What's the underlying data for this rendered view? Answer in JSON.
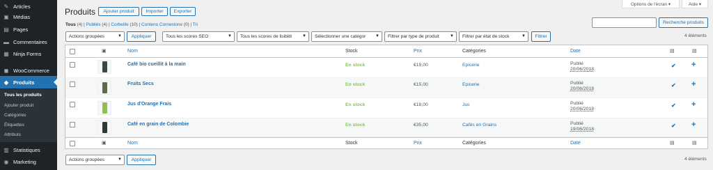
{
  "sidebar": {
    "items": [
      {
        "label": "Articles",
        "icon": "pin-icon"
      },
      {
        "label": "Médias",
        "icon": "media-icon"
      },
      {
        "label": "Pages",
        "icon": "pages-icon"
      },
      {
        "label": "Commentaires",
        "icon": "comments-icon"
      },
      {
        "label": "Ninja Forms",
        "icon": "forms-icon"
      },
      {
        "label": "WooCommerce",
        "icon": "woocommerce-icon"
      },
      {
        "label": "Produits",
        "icon": "products-icon"
      },
      {
        "label": "Statistiques",
        "icon": "stats-icon"
      },
      {
        "label": "Marketing",
        "icon": "marketing-icon"
      }
    ],
    "submenu": [
      "Tous les produits",
      "Ajouter produit",
      "Catégories",
      "Étiquettes",
      "Attributs"
    ]
  },
  "top": {
    "screen_options": "Options de l'écran ▾",
    "help": "Aide ▾"
  },
  "header": {
    "title": "Produits",
    "add_button": "Ajouter produit",
    "import_button": "Importer",
    "export_button": "Exporter",
    "search_button": "Recherche produits"
  },
  "filters": {
    "all": "Tous",
    "all_count": "(4)",
    "published": "Publiés",
    "published_count": "(4)",
    "trash": "Corbeille",
    "trash_count": "(10)",
    "cornerstone": "Contenu Cornestone",
    "cornerstone_count": "(0)",
    "sort": "Tri",
    "separator": "|"
  },
  "toolbar": {
    "bulk_actions": "Actions groupées",
    "apply": "Appliquer",
    "seo_scores": "Tous les scores SEO",
    "readability": "Tous les scores de lisibilit",
    "category": "Sélectionner une catégor",
    "product_type": "Filtrer par type de produit",
    "stock_status": "Filtrer par état de stock",
    "filter": "Filtrer",
    "items_count": "4 éléments"
  },
  "table": {
    "headers": {
      "name": "Nom",
      "stock": "Stock",
      "price": "Prix",
      "categories": "Catégories",
      "date": "Date"
    },
    "rows": [
      {
        "name": "Café bio cueillit à la main",
        "stock": "En stock",
        "price": "€19,00",
        "category": "Epicerie",
        "date_status": "Publié",
        "date": "20/06/2018",
        "thumb_color": "#3c4a3e"
      },
      {
        "name": "Fruits Secs",
        "stock": "En stock",
        "price": "€15,00",
        "category": "Epicerie",
        "date_status": "Publié",
        "date": "20/06/2018",
        "thumb_color": "#5d6b4a"
      },
      {
        "name": "Jus d'Orange Frais",
        "stock": "En stock",
        "price": "€18,00",
        "category": "Jus",
        "date_status": "Publié",
        "date": "20/06/2018",
        "thumb_color": "#8fbf4f"
      },
      {
        "name": "Café en grain de Colombie",
        "stock": "En stock",
        "price": "€35,00",
        "category": "Cafés en Grains",
        "date_status": "Publié",
        "date": "19/06/2018",
        "thumb_color": "#2f3a33"
      }
    ]
  },
  "colors": {
    "accent": "#2271b1",
    "sidebar_bg": "#1d2327",
    "in_stock": "#7ad03a"
  }
}
